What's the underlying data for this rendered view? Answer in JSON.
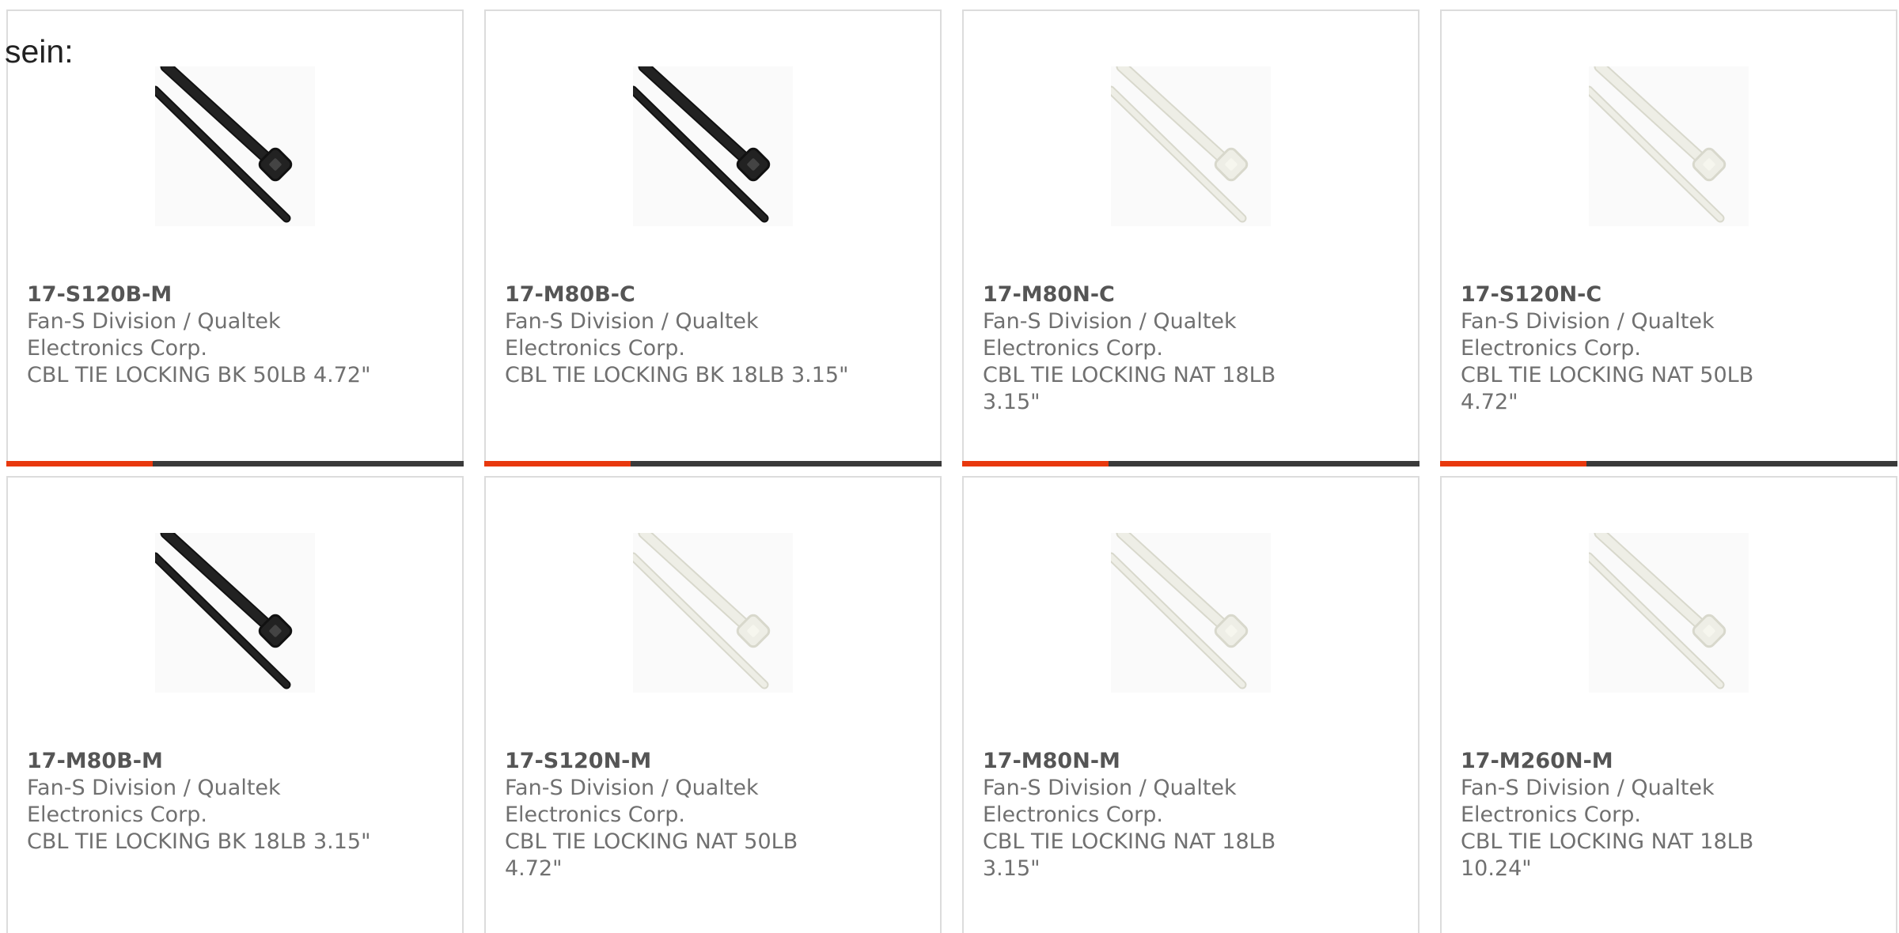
{
  "lead_text": "sein:",
  "colors": {
    "accent": "#e8380d",
    "bar_dark": "#3a3a3a",
    "card_border": "#dcdcdc",
    "text_gray": "#707070",
    "tie_black": "#222222",
    "tie_natural": "#eeeee6"
  },
  "products": [
    {
      "part_number": "17-S120B-M",
      "manufacturer": "Fan-S Division / Qualtek Electronics Corp.",
      "manufacturer_lines": [
        "Fan-S Division / Qualtek",
        "Electronics Corp."
      ],
      "description": "CBL TIE LOCKING BK 50LB 4.72\"",
      "description_lines": [
        "CBL TIE LOCKING BK 50LB 4.72\""
      ],
      "tie_color": "black",
      "icon": "cable-tie-image",
      "bar_accent_fraction": 0.32
    },
    {
      "part_number": "17-M80B-C",
      "manufacturer": "Fan-S Division / Qualtek Electronics Corp.",
      "manufacturer_lines": [
        "Fan-S Division / Qualtek",
        "Electronics Corp."
      ],
      "description": "CBL TIE LOCKING BK 18LB 3.15\"",
      "description_lines": [
        "CBL TIE LOCKING BK 18LB 3.15\""
      ],
      "tie_color": "black",
      "icon": "cable-tie-image",
      "bar_accent_fraction": 0.32
    },
    {
      "part_number": "17-M80N-C",
      "manufacturer": "Fan-S Division / Qualtek Electronics Corp.",
      "manufacturer_lines": [
        "Fan-S Division / Qualtek",
        "Electronics Corp."
      ],
      "description": "CBL TIE LOCKING NAT 18LB 3.15\"",
      "description_lines": [
        "CBL TIE LOCKING NAT 18LB",
        "3.15\""
      ],
      "tie_color": "natural",
      "icon": "cable-tie-image",
      "bar_accent_fraction": 0.32
    },
    {
      "part_number": "17-S120N-C",
      "manufacturer": "Fan-S Division / Qualtek Electronics Corp.",
      "manufacturer_lines": [
        "Fan-S Division / Qualtek",
        "Electronics Corp."
      ],
      "description": "CBL TIE LOCKING NAT 50LB 4.72\"",
      "description_lines": [
        "CBL TIE LOCKING NAT 50LB",
        "4.72\""
      ],
      "tie_color": "natural",
      "icon": "cable-tie-image",
      "bar_accent_fraction": 0.32
    },
    {
      "part_number": "17-M80B-M",
      "manufacturer": "Fan-S Division / Qualtek Electronics Corp.",
      "manufacturer_lines": [
        "Fan-S Division / Qualtek",
        "Electronics Corp."
      ],
      "description": "CBL TIE LOCKING BK 18LB 3.15\"",
      "description_lines": [
        "CBL TIE LOCKING BK 18LB 3.15\""
      ],
      "tie_color": "black",
      "icon": "cable-tie-image"
    },
    {
      "part_number": "17-S120N-M",
      "manufacturer": "Fan-S Division / Qualtek Electronics Corp.",
      "manufacturer_lines": [
        "Fan-S Division / Qualtek",
        "Electronics Corp."
      ],
      "description": "CBL TIE LOCKING NAT 50LB 4.72\"",
      "description_lines": [
        "CBL TIE LOCKING NAT 50LB",
        "4.72\""
      ],
      "tie_color": "natural",
      "icon": "cable-tie-image"
    },
    {
      "part_number": "17-M80N-M",
      "manufacturer": "Fan-S Division / Qualtek Electronics Corp.",
      "manufacturer_lines": [
        "Fan-S Division / Qualtek",
        "Electronics Corp."
      ],
      "description": "CBL TIE LOCKING NAT 18LB 3.15\"",
      "description_lines": [
        "CBL TIE LOCKING NAT 18LB",
        "3.15\""
      ],
      "tie_color": "natural",
      "icon": "cable-tie-image"
    },
    {
      "part_number": "17-M260N-M",
      "manufacturer": "Fan-S Division / Qualtek Electronics Corp.",
      "manufacturer_lines": [
        "Fan-S Division / Qualtek",
        "Electronics Corp."
      ],
      "description": "CBL TIE LOCKING NAT 18LB 10.24\"",
      "description_lines": [
        "CBL TIE LOCKING NAT 18LB",
        "10.24\""
      ],
      "tie_color": "natural",
      "icon": "cable-tie-image"
    }
  ]
}
